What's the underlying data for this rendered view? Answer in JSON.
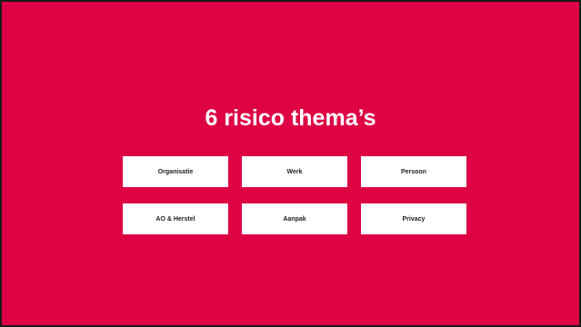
{
  "slide": {
    "title": "6 risico thema’s",
    "background_color": "#dd0344",
    "themes": [
      {
        "label": "Organisatie"
      },
      {
        "label": "Werk"
      },
      {
        "label": "Persoon"
      },
      {
        "label": "AO & Herstel"
      },
      {
        "label": "Aanpak"
      },
      {
        "label": "Privacy"
      }
    ]
  }
}
